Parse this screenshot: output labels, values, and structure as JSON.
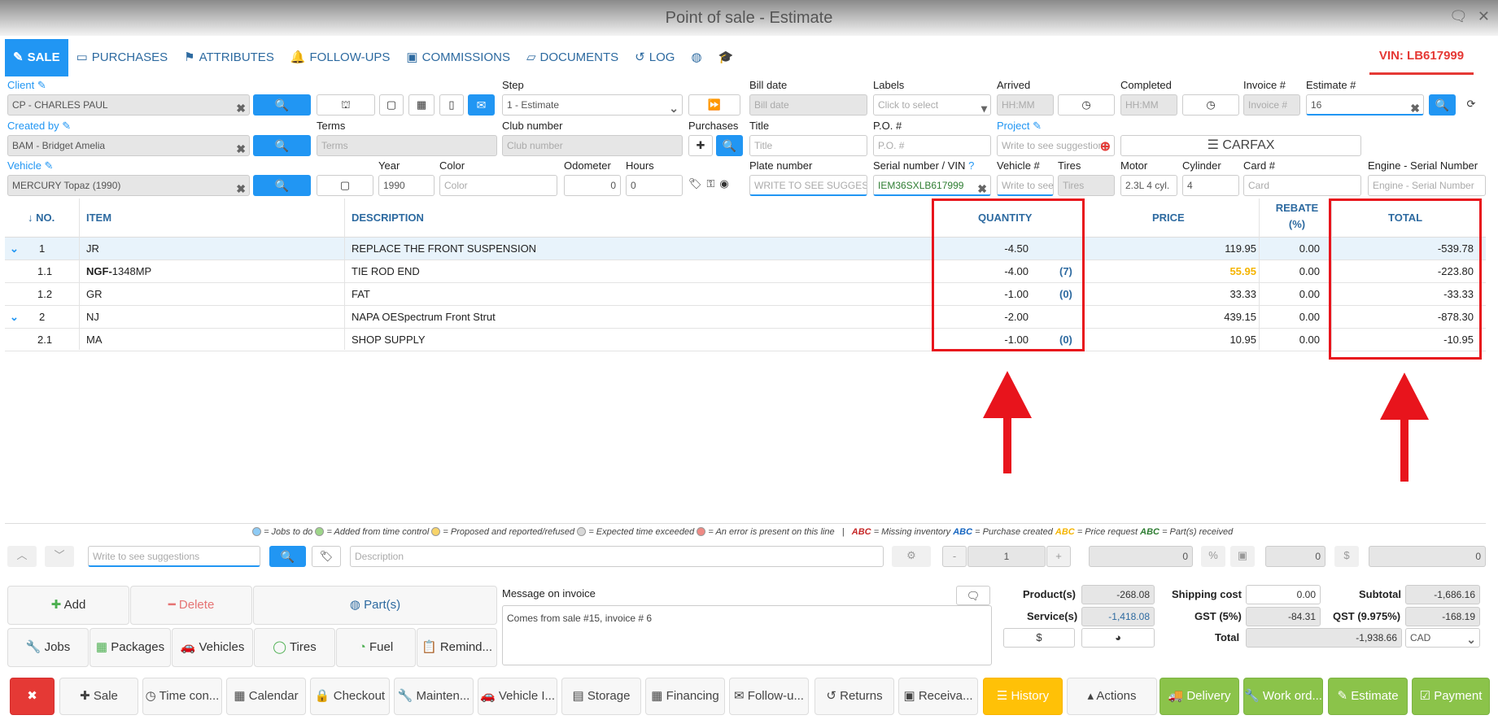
{
  "window": {
    "title": "Point of sale - Estimate"
  },
  "tabs": [
    {
      "label": "SALE"
    },
    {
      "label": "PURCHASES"
    },
    {
      "label": "ATTRIBUTES"
    },
    {
      "label": "FOLLOW-UPS"
    },
    {
      "label": "COMMISSIONS"
    },
    {
      "label": "DOCUMENTS"
    },
    {
      "label": "LOG"
    }
  ],
  "vin": "VIN: LB617999",
  "header": {
    "client_label": "Client",
    "client_value": "CP - CHARLES PAUL",
    "step_label": "Step",
    "step_value": "1 - Estimate",
    "bill_date_label": "Bill date",
    "bill_date_placeholder": "Bill date",
    "labels_label": "Labels",
    "labels_placeholder": "Click to select",
    "arrived_label": "Arrived",
    "arrived_placeholder": "HH:MM",
    "completed_label": "Completed",
    "completed_placeholder": "HH:MM",
    "invoice_label": "Invoice #",
    "invoice_placeholder": "Invoice #",
    "estimate_label": "Estimate #",
    "estimate_value": "16",
    "created_by_label": "Created by",
    "created_by_value": "BAM - Bridget Amelia",
    "terms_label": "Terms",
    "terms_placeholder": "Terms",
    "club_label": "Club number",
    "club_placeholder": "Club number",
    "purchases_label": "Purchases",
    "title_label": "Title",
    "title_placeholder": "Title",
    "po_label": "P.O. #",
    "po_placeholder": "P.O. #",
    "project_label": "Project",
    "project_placeholder": "Write to see suggestions",
    "carfax": "CARFAX",
    "vehicle_label": "Vehicle",
    "vehicle_value": "MERCURY Topaz (1990)",
    "year_label": "Year",
    "year_value": "1990",
    "color_label": "Color",
    "color_placeholder": "Color",
    "odometer_label": "Odometer",
    "odometer_value": "0",
    "hours_label": "Hours",
    "hours_value": "0",
    "plate_label": "Plate number",
    "plate_placeholder": "WRITE TO SEE SUGGESTIONS",
    "serial_label": "Serial number / VIN",
    "serial_value": "IEM36SXLB617999",
    "vehicle_num_label": "Vehicle #",
    "vehicle_num_placeholder": "Write to see",
    "tires_label": "Tires",
    "tires_placeholder": "Tires",
    "motor_label": "Motor",
    "motor_value": "2.3L  4 cyl.",
    "cylinder_label": "Cylinder",
    "cylinder_value": "4",
    "card_label": "Card #",
    "card_placeholder": "Card",
    "engine_label": "Engine - Serial Number",
    "engine_placeholder": "Engine - Serial Number"
  },
  "grid": {
    "headers": {
      "no": "↓ NO.",
      "item": "ITEM",
      "description": "DESCRIPTION",
      "quantity": "QUANTITY",
      "price": "PRICE",
      "rebate": "REBATE",
      "rebate_unit": "(%)",
      "total": "TOTAL"
    },
    "rows": [
      {
        "no": "1",
        "item_bold": "",
        "item": "JR",
        "description": "REPLACE THE FRONT SUSPENSION",
        "quantity": "-4.50",
        "count": "",
        "price": "119.95",
        "rebate": "0.00",
        "total": "-539.78"
      },
      {
        "no": "1.1",
        "item_bold": "NGF-",
        "item": "1348MP",
        "description": "TIE ROD END",
        "quantity": "-4.00",
        "count": "(7)",
        "price": "55.95",
        "rebate": "0.00",
        "total": "-223.80"
      },
      {
        "no": "1.2",
        "item_bold": "",
        "item": "GR",
        "description": "FAT",
        "quantity": "-1.00",
        "count": "(0)",
        "price": "33.33",
        "rebate": "0.00",
        "total": "-33.33"
      },
      {
        "no": "2",
        "item_bold": "",
        "item": "NJ",
        "description": "NAPA OESpectrum Front Strut",
        "quantity": "-2.00",
        "count": "",
        "price": "439.15",
        "rebate": "0.00",
        "total": "-878.30"
      },
      {
        "no": "2.1",
        "item_bold": "",
        "item": "MA",
        "description": "SHOP SUPPLY",
        "quantity": "-1.00",
        "count": "(0)",
        "price": "10.95",
        "rebate": "0.00",
        "total": "-10.95"
      }
    ]
  },
  "legend": {
    "jobs": "= Jobs to do",
    "added": "= Added from time control",
    "proposed": "= Proposed and reported/refused",
    "exceeded": "= Expected time exceeded",
    "error": "= An error is present on this line",
    "sep": "|",
    "abc": "ABC",
    "missing": "= Missing inventory",
    "purchase": "= Purchase created",
    "price_req": "= Price request",
    "received": "= Part(s) received"
  },
  "entry": {
    "suggest_placeholder": "Write to see suggestions",
    "description_placeholder": "Description",
    "minus": "-",
    "qty": "1",
    "plus": "+",
    "v1": "0",
    "pct": "%",
    "v2": "0",
    "dollar": "$",
    "v3": "0"
  },
  "actions": {
    "add": "Add",
    "delete": "Delete",
    "parts": "Part(s)",
    "jobs": "Jobs",
    "packages": "Packages",
    "vehicles": "Vehicles",
    "tires": "Tires",
    "fuel": "Fuel",
    "reminders": "Remind..."
  },
  "message": {
    "label": "Message on invoice",
    "text": "Comes from sale #15, invoice # 6"
  },
  "totals": {
    "products_label": "Product(s)",
    "products": "-268.08",
    "services_label": "Service(s)",
    "services": "-1,418.08",
    "dollar": "$",
    "shipping_label": "Shipping cost",
    "shipping": "0.00",
    "gst_label": "GST (5%)",
    "gst": "-84.31",
    "total_label": "Total",
    "total": "-1,938.66",
    "subtotal_label": "Subtotal",
    "subtotal": "-1,686.16",
    "qst_label": "QST (9.975%)",
    "qst": "-168.19",
    "currency": "CAD"
  },
  "bottom": {
    "close": "✖",
    "sale": "Sale",
    "time": "Time con...",
    "calendar": "Calendar",
    "checkout": "Checkout",
    "maintenance": "Mainten...",
    "vehicle": "Vehicle I...",
    "storage": "Storage",
    "financing": "Financing",
    "followup": "Follow-u...",
    "returns": "Returns",
    "receivables": "Receiva...",
    "history": "History",
    "actions": "Actions",
    "delivery": "Delivery",
    "workorder": "Work ord...",
    "estimate": "Estimate",
    "payment": "Payment"
  },
  "colors": {
    "accent": "#2196f3",
    "highlight": "#e8141c",
    "green": "#8bc34a",
    "yellow": "#ffc107",
    "price_warning": "#f5b400"
  }
}
